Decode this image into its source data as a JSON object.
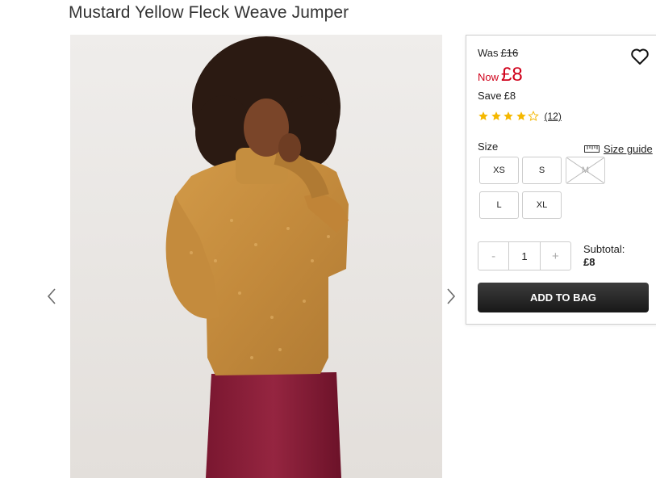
{
  "product": {
    "title": "Mustard Yellow Fleck Weave Jumper"
  },
  "gallery": {
    "image_alt": "model wearing mustard yellow fleck weave jumper and burgundy skirt"
  },
  "pricing": {
    "was_label": "Was",
    "was_price": "£16",
    "now_label": "Now",
    "now_price": "£8",
    "save_label": "Save",
    "save_amount": "£8"
  },
  "rating": {
    "stars": 4,
    "out_of": 5,
    "review_count": "(12)"
  },
  "sizes": {
    "label": "Size",
    "guide_label": "Size guide",
    "options": [
      {
        "label": "XS",
        "available": true
      },
      {
        "label": "S",
        "available": true
      },
      {
        "label": "M",
        "available": false
      },
      {
        "label": "L",
        "available": true
      },
      {
        "label": "XL",
        "available": true
      }
    ]
  },
  "quantity": {
    "minus": "-",
    "value": "1",
    "plus": "+"
  },
  "subtotal": {
    "label": "Subtotal:",
    "value": "£8"
  },
  "cta": {
    "add_label": "ADD TO BAG"
  },
  "colors": {
    "price_now": "#d0021b",
    "star": "#f5b800",
    "button_bg": "#222222"
  },
  "icons": [
    "chevron-left-icon",
    "chevron-right-icon",
    "heart-icon",
    "star-icon",
    "ruler-icon"
  ]
}
